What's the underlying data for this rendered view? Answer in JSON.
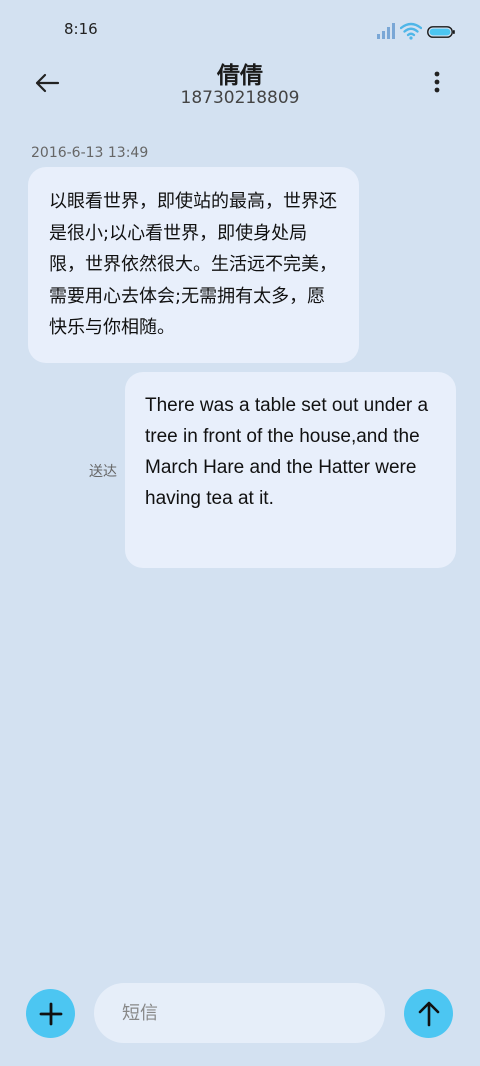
{
  "status_bar": {
    "time": "8:16",
    "signal_icon": "signal-icon",
    "wifi_icon": "wifi-icon",
    "battery_icon": "battery-icon"
  },
  "header": {
    "back_icon": "arrow-left-icon",
    "contact_name": "倩倩",
    "contact_number": "18730218809",
    "more_icon": "more-vertical-icon"
  },
  "conversation": {
    "timestamp": "2016-6-13 13:49",
    "messages": [
      {
        "direction": "received",
        "text": "以眼看世界，即使站的最高，世界还是很小;以心看世界，即使身处局限，世界依然很大。生活远不完美，需要用心去体会;无需拥有太多，愿快乐与你相随。"
      },
      {
        "direction": "sent",
        "status": "送达",
        "text": "There was a table set out under a tree in front of the house,and the March Hare and the Hatter were having tea at it."
      }
    ]
  },
  "composer": {
    "attach_icon": "plus-icon",
    "placeholder": "短信",
    "send_icon": "arrow-up-icon"
  },
  "colors": {
    "background": "#d3e1f1",
    "bubble": "#e8effb",
    "accent": "#4cc6f2"
  }
}
